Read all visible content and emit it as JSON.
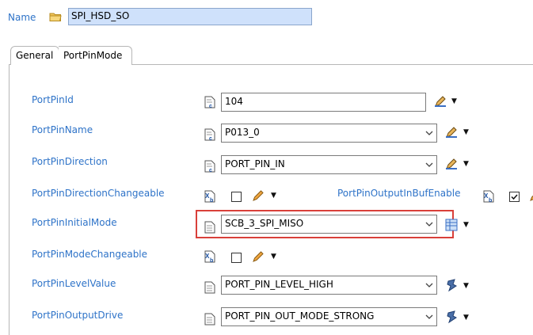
{
  "name": {
    "label": "Name",
    "value": "SPI_HSD_SO"
  },
  "tabs": [
    {
      "label": "General"
    },
    {
      "label": "PortPinMode"
    }
  ],
  "rows": {
    "portpinid": {
      "label": "PortPinId",
      "value": "104"
    },
    "portpinname": {
      "label": "PortPinName",
      "value": "P013_0"
    },
    "portpindirection": {
      "label": "PortPinDirection",
      "value": "PORT_PIN_IN"
    },
    "directionchangeable": {
      "label": "PortPinDirectionChangeable",
      "checked": false
    },
    "outputinbufenable": {
      "label": "PortPinOutputInBufEnable",
      "checked": true
    },
    "initialmode": {
      "label": "PortPinInitialMode",
      "value": "SCB_3_SPI_MISO"
    },
    "modechangeable": {
      "label": "PortPinModeChangeable",
      "checked": false
    },
    "levelvalue": {
      "label": "PortPinLevelValue",
      "value": "PORT_PIN_LEVEL_HIGH"
    },
    "outputdrive": {
      "label": "PortPinOutputDrive",
      "value": "PORT_PIN_OUT_MODE_STRONG"
    }
  },
  "colors": {
    "label_blue": "#2e73c8",
    "highlight_red": "#d9403a",
    "name_field_bg": "#cfe1fb"
  }
}
